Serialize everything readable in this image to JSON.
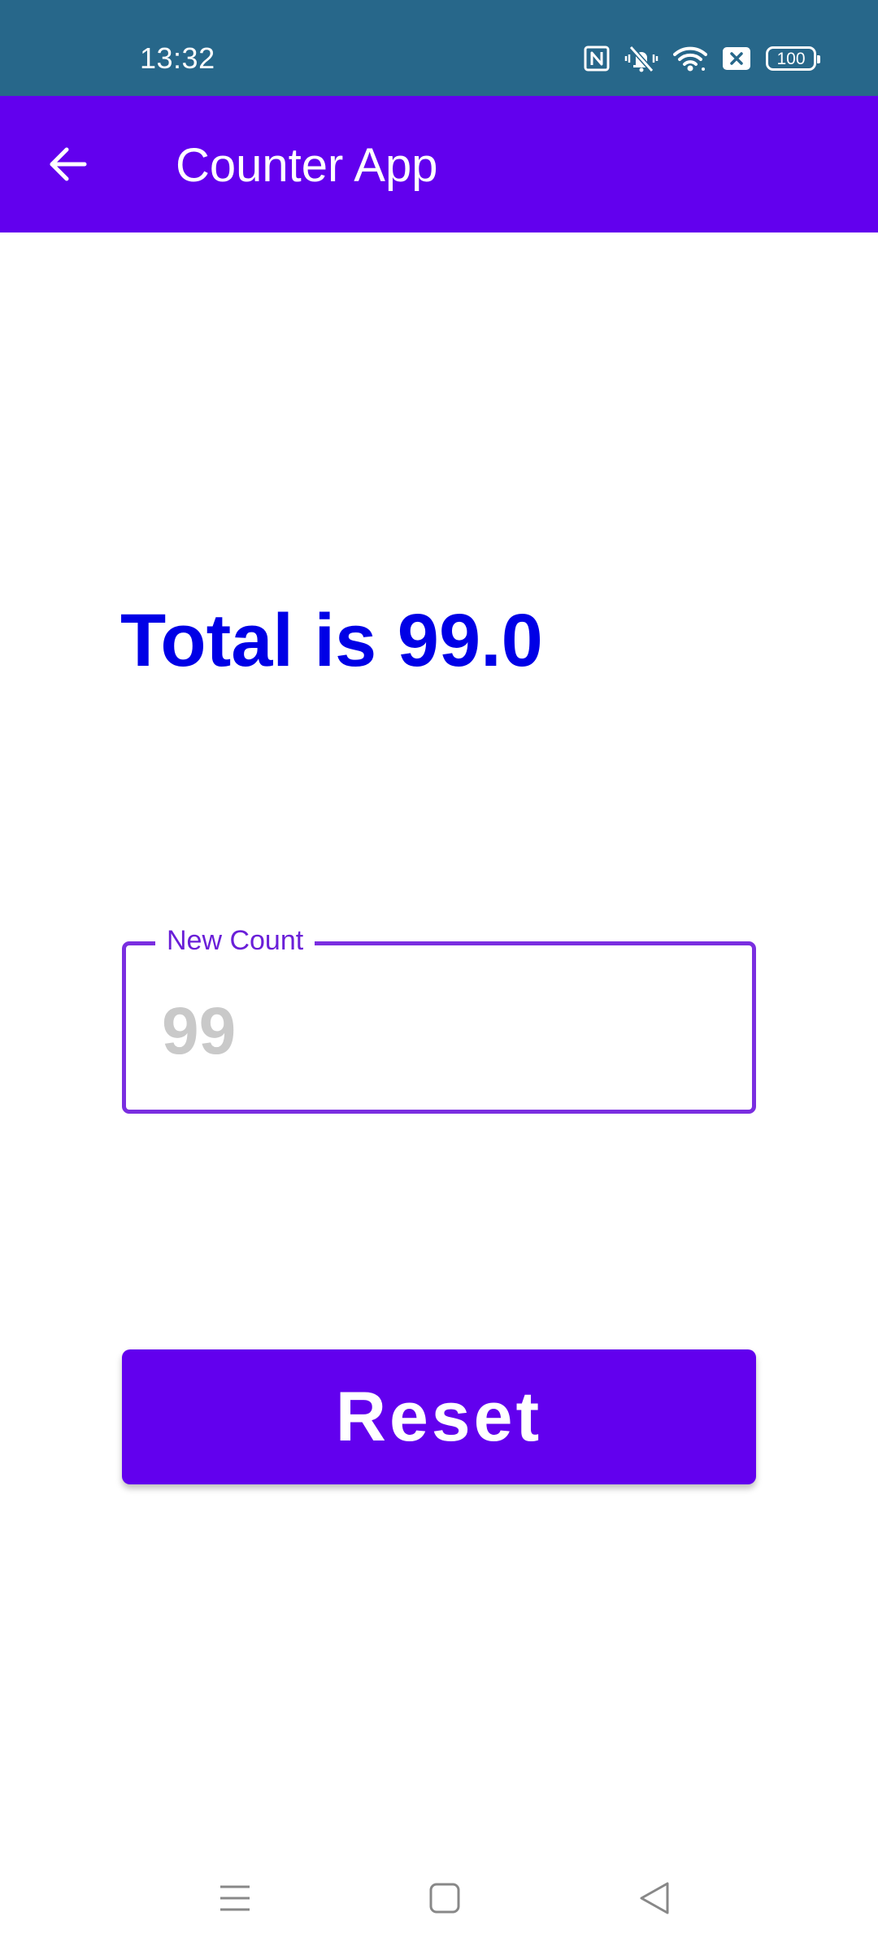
{
  "status_bar": {
    "time": "13:32",
    "battery_level": "100",
    "icons": [
      "nfc-icon",
      "vibrate-off-icon",
      "wifi-icon",
      "sim-off-icon",
      "battery-icon"
    ],
    "background_color": "#27678a"
  },
  "app_bar": {
    "title": "Counter App",
    "back_icon": "arrow-left-icon",
    "background_color": "#6200ee"
  },
  "main": {
    "total_text": "Total is 99.0",
    "total_color": "#0000e6",
    "count_field": {
      "label": "New Count",
      "placeholder": "99",
      "value": ""
    },
    "reset_button": {
      "label": "Reset",
      "color": "#6200ee"
    }
  },
  "nav_bar": {
    "buttons": [
      "menu-icon",
      "home-icon",
      "back-triangle-icon"
    ]
  }
}
